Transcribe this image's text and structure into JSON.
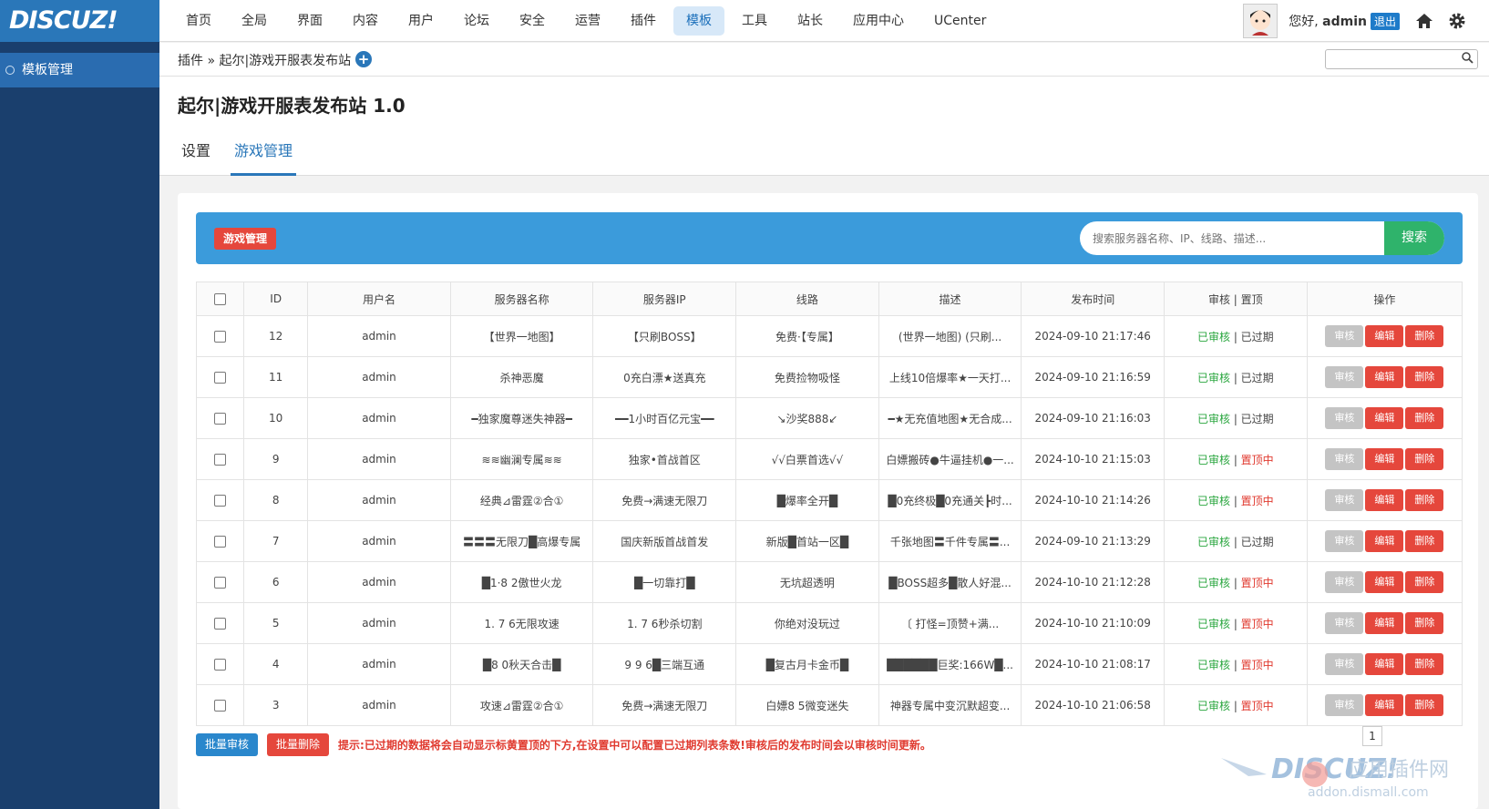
{
  "app": {
    "logo": "DISCUZ!"
  },
  "nav": [
    "首页",
    "全局",
    "界面",
    "内容",
    "用户",
    "论坛",
    "安全",
    "运营",
    "插件",
    "模板",
    "工具",
    "站长",
    "应用中心",
    "UCenter"
  ],
  "user": {
    "greet": "您好,",
    "name": "admin",
    "logout": "退出"
  },
  "sidebar": {
    "item": "模板管理"
  },
  "breadcrumb": "插件 » 起尔|游戏开服表发布站",
  "page": {
    "title": "起尔|游戏开服表发布站 1.0"
  },
  "tabs": [
    "设置",
    "游戏管理"
  ],
  "toolbar": {
    "badge": "游戏管理",
    "search_placeholder": "搜索服务器名称、IP、线路、描述...",
    "search_btn": "搜索"
  },
  "table": {
    "headers": [
      "ID",
      "用户名",
      "服务器名称",
      "服务器IP",
      "线路",
      "描述",
      "发布时间",
      "审核 | 置顶",
      "操作"
    ],
    "rows": [
      {
        "id": "12",
        "user": "admin",
        "name": "【世界一地图】",
        "ip": "【只刷BOSS】",
        "line": "免费·【专属】",
        "desc": "(世界一地图) (只刷...",
        "time": "2024-09-10 21:17:46",
        "status": "已审核",
        "sep": " | ",
        "top": "已过期",
        "top_red": false
      },
      {
        "id": "11",
        "user": "admin",
        "name": "杀神恶魔",
        "ip": "0充白漂★送真充",
        "line": "免费捡物吸怪",
        "desc": "上线10倍爆率★一天打...",
        "time": "2024-09-10 21:16:59",
        "status": "已审核",
        "sep": " | ",
        "top": "已过期",
        "top_red": false
      },
      {
        "id": "10",
        "user": "admin",
        "name": "━独家魔尊迷失神器━",
        "ip": "━━1小时百亿元宝━━",
        "line": "↘沙奖888↙",
        "desc": "━★无充值地图★无合成...",
        "time": "2024-09-10 21:16:03",
        "status": "已审核",
        "sep": " | ",
        "top": "已过期",
        "top_red": false
      },
      {
        "id": "9",
        "user": "admin",
        "name": "≋≋幽澜专属≋≋",
        "ip": "独家•首战首区",
        "line": "√√白票首选√√",
        "desc": "白嫖搬砖●牛逼挂机●一...",
        "time": "2024-10-10 21:15:03",
        "status": "已审核",
        "sep": " | ",
        "top": "置顶中",
        "top_red": true
      },
      {
        "id": "8",
        "user": "admin",
        "name": "经典⊿雷霆②合①",
        "ip": "免费→满速无限刀",
        "line": "█爆率全开█",
        "desc": "█0充终极█0充通关┣时...",
        "time": "2024-10-10 21:14:26",
        "status": "已审核",
        "sep": " | ",
        "top": "置顶中",
        "top_red": true
      },
      {
        "id": "7",
        "user": "admin",
        "name": "〓〓〓无限刀█高爆专属",
        "ip": "国庆新版首战首发",
        "line": "新版█首站一区█",
        "desc": "千张地图〓千件专属〓...",
        "time": "2024-09-10 21:13:29",
        "status": "已审核",
        "sep": " | ",
        "top": "已过期",
        "top_red": false
      },
      {
        "id": "6",
        "user": "admin",
        "name": "█1·8 2傲世火龙",
        "ip": "█一切靠打█",
        "line": "无坑超透明",
        "desc": "█BOSS超多█散人好混...",
        "time": "2024-10-10 21:12:28",
        "status": "已审核",
        "sep": " | ",
        "top": "置顶中",
        "top_red": true
      },
      {
        "id": "5",
        "user": "admin",
        "name": "1. 7 6无限攻速",
        "ip": "1. 7 6秒杀切割",
        "line": "你绝对没玩过",
        "desc": "〔 打怪=顶赞+满...",
        "time": "2024-10-10 21:10:09",
        "status": "已审核",
        "sep": " | ",
        "top": "置顶中",
        "top_red": true
      },
      {
        "id": "4",
        "user": "admin",
        "name": "█8 0秋天合击█",
        "ip": "9 9 6█三端互通",
        "line": "█复古月卡金币█",
        "desc": "██████巨奖:166W█...",
        "time": "2024-10-10 21:08:17",
        "status": "已审核",
        "sep": " | ",
        "top": "置顶中",
        "top_red": true
      },
      {
        "id": "3",
        "user": "admin",
        "name": "攻速⊿雷霆②合①",
        "ip": "免费→满速无限刀",
        "line": "白嫖8 5微变迷失",
        "desc": "神器专属中变沉默超变...",
        "time": "2024-10-10 21:06:58",
        "status": "已审核",
        "sep": " | ",
        "top": "置顶中",
        "top_red": true
      }
    ],
    "actions": {
      "review": "审核",
      "edit": "编辑",
      "delete": "删除"
    }
  },
  "footer": {
    "batch_review": "批量审核",
    "batch_delete": "批量删除",
    "tip": "提示:已过期的数据将会自动显示标黄置顶的下方,在设置中可以配置已过期列表条数!审核后的发布时间会以审核时间更新。",
    "page": "1"
  },
  "watermark": {
    "brand": "DISCUZ!",
    "site": "addon.dismall.com",
    "cn": "应用插件网"
  },
  "colors": {
    "logo_bg": "#2a77b9",
    "sidebar_bg": "#1a3f6d",
    "toolbar_bg": "#3b9bdb",
    "approved": "#2aa63f",
    "pinned": "#e03a2f",
    "danger": "#e5473c",
    "search_btn": "#2fb36b"
  }
}
